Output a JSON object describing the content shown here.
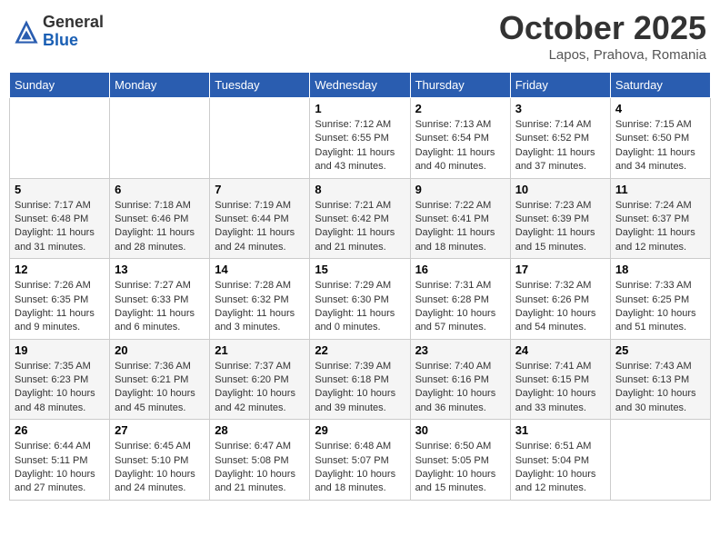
{
  "header": {
    "logo": {
      "general": "General",
      "blue": "Blue"
    },
    "title": "October 2025",
    "location": "Lapos, Prahova, Romania"
  },
  "weekdays": [
    "Sunday",
    "Monday",
    "Tuesday",
    "Wednesday",
    "Thursday",
    "Friday",
    "Saturday"
  ],
  "weeks": [
    [
      {
        "day": "",
        "info": ""
      },
      {
        "day": "",
        "info": ""
      },
      {
        "day": "",
        "info": ""
      },
      {
        "day": "1",
        "info": "Sunrise: 7:12 AM\nSunset: 6:55 PM\nDaylight: 11 hours and 43 minutes."
      },
      {
        "day": "2",
        "info": "Sunrise: 7:13 AM\nSunset: 6:54 PM\nDaylight: 11 hours and 40 minutes."
      },
      {
        "day": "3",
        "info": "Sunrise: 7:14 AM\nSunset: 6:52 PM\nDaylight: 11 hours and 37 minutes."
      },
      {
        "day": "4",
        "info": "Sunrise: 7:15 AM\nSunset: 6:50 PM\nDaylight: 11 hours and 34 minutes."
      }
    ],
    [
      {
        "day": "5",
        "info": "Sunrise: 7:17 AM\nSunset: 6:48 PM\nDaylight: 11 hours and 31 minutes."
      },
      {
        "day": "6",
        "info": "Sunrise: 7:18 AM\nSunset: 6:46 PM\nDaylight: 11 hours and 28 minutes."
      },
      {
        "day": "7",
        "info": "Sunrise: 7:19 AM\nSunset: 6:44 PM\nDaylight: 11 hours and 24 minutes."
      },
      {
        "day": "8",
        "info": "Sunrise: 7:21 AM\nSunset: 6:42 PM\nDaylight: 11 hours and 21 minutes."
      },
      {
        "day": "9",
        "info": "Sunrise: 7:22 AM\nSunset: 6:41 PM\nDaylight: 11 hours and 18 minutes."
      },
      {
        "day": "10",
        "info": "Sunrise: 7:23 AM\nSunset: 6:39 PM\nDaylight: 11 hours and 15 minutes."
      },
      {
        "day": "11",
        "info": "Sunrise: 7:24 AM\nSunset: 6:37 PM\nDaylight: 11 hours and 12 minutes."
      }
    ],
    [
      {
        "day": "12",
        "info": "Sunrise: 7:26 AM\nSunset: 6:35 PM\nDaylight: 11 hours and 9 minutes."
      },
      {
        "day": "13",
        "info": "Sunrise: 7:27 AM\nSunset: 6:33 PM\nDaylight: 11 hours and 6 minutes."
      },
      {
        "day": "14",
        "info": "Sunrise: 7:28 AM\nSunset: 6:32 PM\nDaylight: 11 hours and 3 minutes."
      },
      {
        "day": "15",
        "info": "Sunrise: 7:29 AM\nSunset: 6:30 PM\nDaylight: 11 hours and 0 minutes."
      },
      {
        "day": "16",
        "info": "Sunrise: 7:31 AM\nSunset: 6:28 PM\nDaylight: 10 hours and 57 minutes."
      },
      {
        "day": "17",
        "info": "Sunrise: 7:32 AM\nSunset: 6:26 PM\nDaylight: 10 hours and 54 minutes."
      },
      {
        "day": "18",
        "info": "Sunrise: 7:33 AM\nSunset: 6:25 PM\nDaylight: 10 hours and 51 minutes."
      }
    ],
    [
      {
        "day": "19",
        "info": "Sunrise: 7:35 AM\nSunset: 6:23 PM\nDaylight: 10 hours and 48 minutes."
      },
      {
        "day": "20",
        "info": "Sunrise: 7:36 AM\nSunset: 6:21 PM\nDaylight: 10 hours and 45 minutes."
      },
      {
        "day": "21",
        "info": "Sunrise: 7:37 AM\nSunset: 6:20 PM\nDaylight: 10 hours and 42 minutes."
      },
      {
        "day": "22",
        "info": "Sunrise: 7:39 AM\nSunset: 6:18 PM\nDaylight: 10 hours and 39 minutes."
      },
      {
        "day": "23",
        "info": "Sunrise: 7:40 AM\nSunset: 6:16 PM\nDaylight: 10 hours and 36 minutes."
      },
      {
        "day": "24",
        "info": "Sunrise: 7:41 AM\nSunset: 6:15 PM\nDaylight: 10 hours and 33 minutes."
      },
      {
        "day": "25",
        "info": "Sunrise: 7:43 AM\nSunset: 6:13 PM\nDaylight: 10 hours and 30 minutes."
      }
    ],
    [
      {
        "day": "26",
        "info": "Sunrise: 6:44 AM\nSunset: 5:11 PM\nDaylight: 10 hours and 27 minutes."
      },
      {
        "day": "27",
        "info": "Sunrise: 6:45 AM\nSunset: 5:10 PM\nDaylight: 10 hours and 24 minutes."
      },
      {
        "day": "28",
        "info": "Sunrise: 6:47 AM\nSunset: 5:08 PM\nDaylight: 10 hours and 21 minutes."
      },
      {
        "day": "29",
        "info": "Sunrise: 6:48 AM\nSunset: 5:07 PM\nDaylight: 10 hours and 18 minutes."
      },
      {
        "day": "30",
        "info": "Sunrise: 6:50 AM\nSunset: 5:05 PM\nDaylight: 10 hours and 15 minutes."
      },
      {
        "day": "31",
        "info": "Sunrise: 6:51 AM\nSunset: 5:04 PM\nDaylight: 10 hours and 12 minutes."
      },
      {
        "day": "",
        "info": ""
      }
    ]
  ]
}
